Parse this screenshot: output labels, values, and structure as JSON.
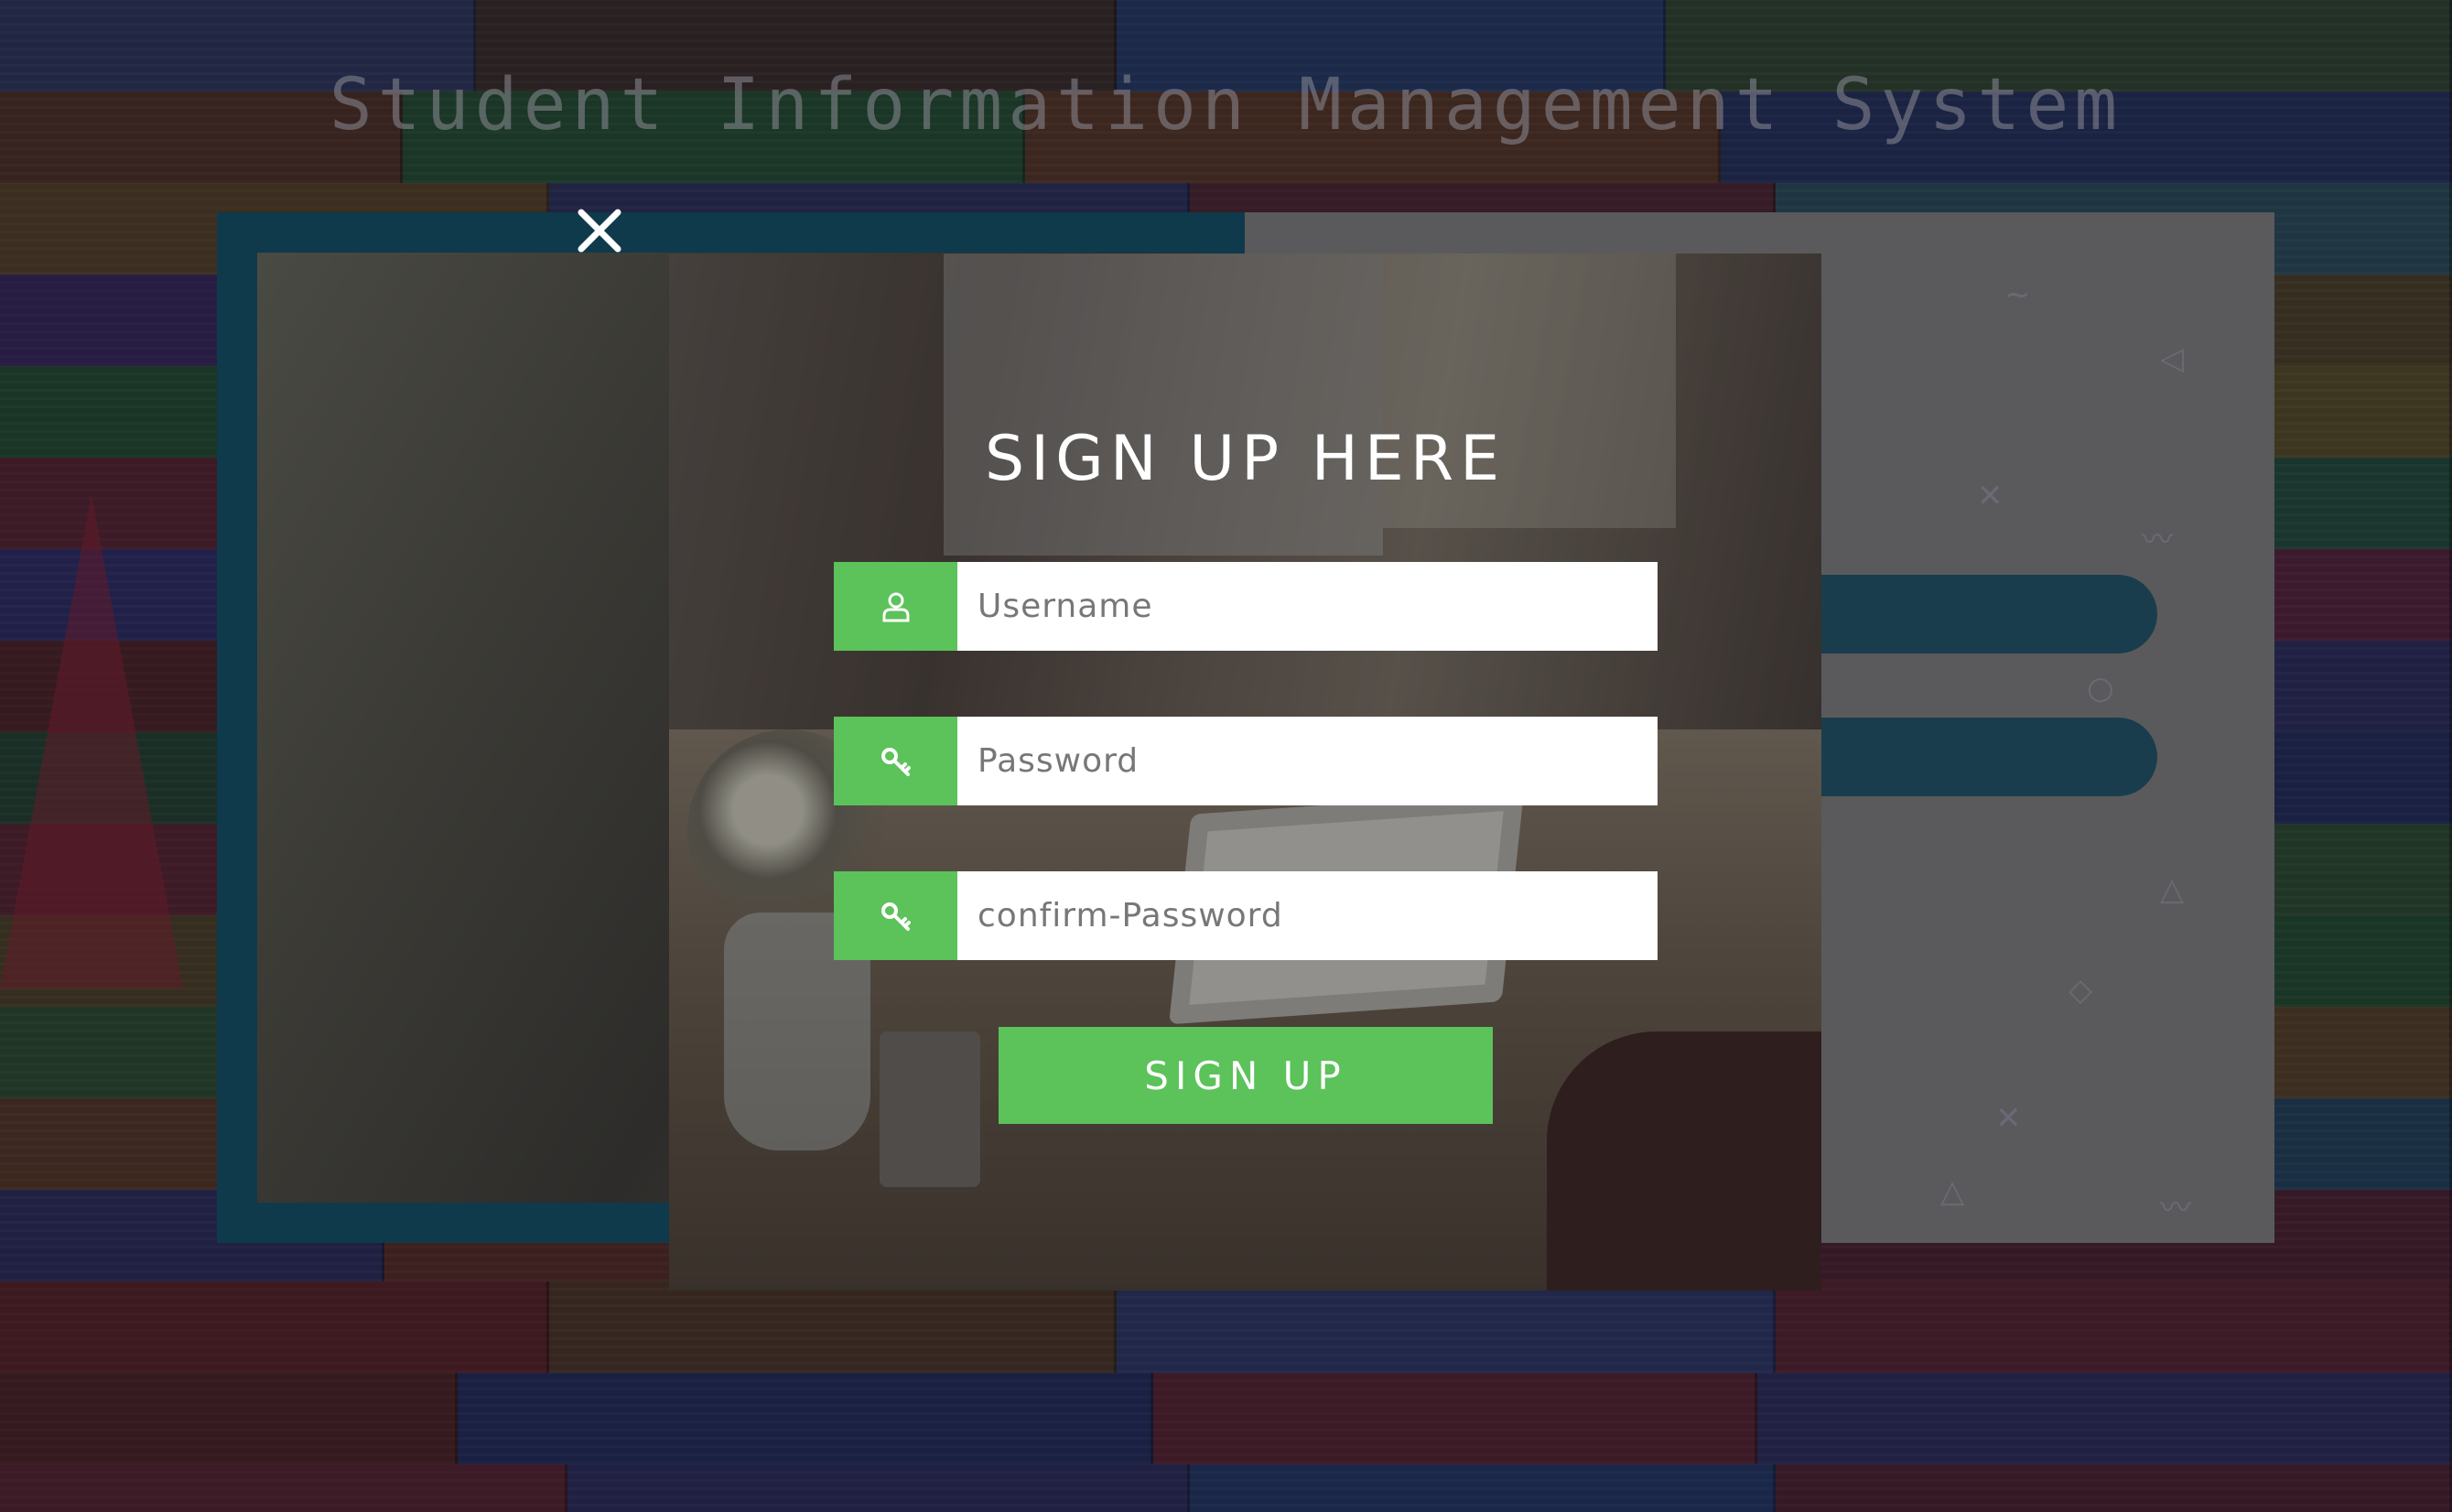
{
  "page": {
    "site_title": "Student Information Management System"
  },
  "modal": {
    "title": "SIGN UP HERE",
    "username": {
      "placeholder": "Username",
      "value": "",
      "icon": "user-icon"
    },
    "password": {
      "placeholder": "Password",
      "value": "",
      "icon": "key-icon"
    },
    "confirm_password": {
      "placeholder": "confirm-Password",
      "value": "",
      "icon": "key-icon"
    },
    "submit_label": "SIGN UP",
    "close_icon": "close-icon"
  },
  "colors": {
    "accent_green": "#5cc25a",
    "panel_teal": "#0f3a4c",
    "title_white": "#ffffff"
  }
}
